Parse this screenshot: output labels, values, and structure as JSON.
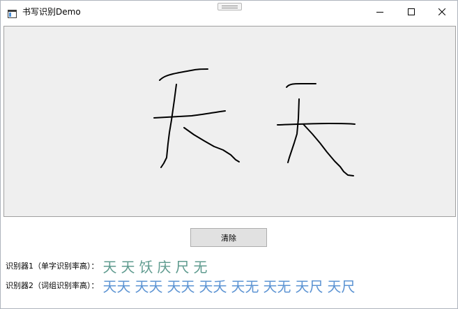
{
  "window": {
    "title": "书写识别Demo"
  },
  "canvas": {
    "strokes": [
      "M227,113 C232,108 238,106 246,104 C254,102 262,101 272,99 C281,97 288,97 296,97",
      "M251,119 L248,142 L244,170 L241,188 L239,204 L237,224 L233,232 L229,238",
      "M219,167 C238,166 255,165 273,164 C290,162 306,159 321,157",
      "M262,181 L276,191 L291,200 L305,208 L318,213 L329,220 L336,227 L341,230",
      "M409,123 C413,118 420,118 430,118 L451,118",
      "M427,140 L426,168 L424,190 L420,203 L416,215 L413,224 L411,231",
      "M396,177 C425,176 448,175 470,175 C486,175 497,175 507,176",
      "M433,176 L446,190 L457,203 L467,216 L478,229 L486,237 L491,244 L497,249 L505,250"
    ]
  },
  "clear_button": {
    "label": "清除"
  },
  "recognizer1": {
    "label": "识别器1（单字识别率高）：",
    "candidates": [
      "天",
      "天",
      "饫",
      "庆",
      "尺",
      "无"
    ]
  },
  "recognizer2": {
    "label": "识别器2（词组识别率高）：",
    "candidates": [
      "天天",
      "天天",
      "天天",
      "天夭",
      "天无",
      "天无",
      "天尺",
      "天尺"
    ]
  }
}
